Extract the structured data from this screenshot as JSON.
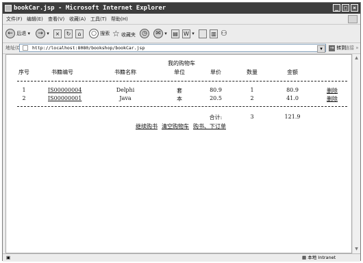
{
  "window": {
    "title": "bookCar.jsp - Microsoft Internet Explorer"
  },
  "menu": [
    "文件(F)",
    "编辑(E)",
    "查看(V)",
    "收藏(A)",
    "工具(T)",
    "帮助(H)"
  ],
  "toolbar": {
    "back": "后退",
    "search": "搜索",
    "favorites": "收藏夹"
  },
  "address": {
    "label": "地址(D)",
    "url": "http://localhost:8080/bookshop/bookCar.jsp",
    "go": "转到",
    "links": "链接"
  },
  "cart": {
    "title": "我的购物车",
    "headers": [
      "序号",
      "书籍编号",
      "书籍名称",
      "单位",
      "单价",
      "数量",
      "金额"
    ],
    "rows": [
      {
        "no": "1",
        "id": "IS00000004",
        "name": "Delphi",
        "unit": "套",
        "price": "80.9",
        "qty": "1",
        "amount": "80.9",
        "action": "删除"
      },
      {
        "no": "2",
        "id": "IS00000001",
        "name": "Java",
        "unit": "本",
        "price": "20.5",
        "qty": "2",
        "amount": "41.0",
        "action": "删除"
      }
    ],
    "total_label": "合计:",
    "total_qty": "3",
    "total_amount": "121.9",
    "links": [
      "继续购书",
      "清空购物车",
      "购书、下订单"
    ]
  },
  "status": {
    "zone": "本地 Intranet"
  }
}
